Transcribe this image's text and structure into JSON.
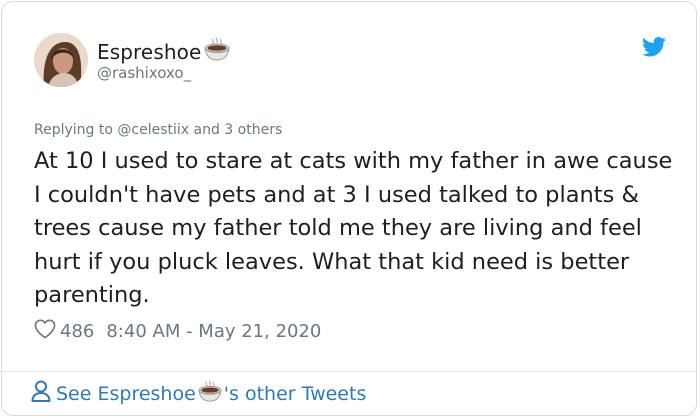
{
  "author": {
    "display_name": "Espreshoe",
    "handle": "@rashixoxo_",
    "name_emoji_icon": "coffee-cup-icon",
    "avatar_icon": "avatar-photo"
  },
  "platform_icon": "twitter-bird-icon",
  "reply_context": {
    "prefix": "Replying to",
    "mention": "@celestiix",
    "suffix": "and 3 others"
  },
  "tweet": {
    "text": "At 10 I used to stare at cats with my father in awe cause I couldn't have pets and at 3 I used talked to plants & trees cause my father told me they are living and feel hurt if you pluck leaves. What that kid need is better parenting."
  },
  "meta": {
    "like_icon": "heart-icon",
    "likes": "486",
    "timestamp": "8:40 AM - May 21, 2020"
  },
  "footer": {
    "person_icon": "person-icon",
    "prefix": "See Espreshoe",
    "suffix": "'s other Tweets"
  },
  "colors": {
    "link_blue": "#2b7bb9",
    "twitter_blue": "#1da1f2",
    "muted_gray": "#697882",
    "text": "#1c2022"
  }
}
